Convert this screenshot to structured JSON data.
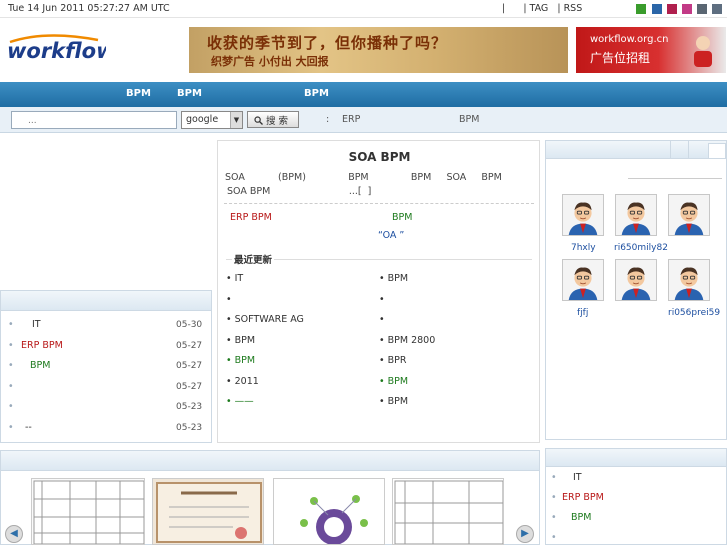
{
  "topbar": {
    "datetime": "Tue 14 Jun 2011 05:27:27 AM UTC",
    "links": "|      | TAG   | RSS",
    "swatch_colors": [
      "#3a9c2c",
      "#2b66a8",
      "#b0204e",
      "#c23a86",
      "#5a6672",
      "#5e6e80"
    ]
  },
  "header": {
    "logo_text": "workflow",
    "banner1": {
      "line1": "收获的季节到了，但你播种了吗？",
      "line2": "织梦广告  小付出  大回报"
    },
    "banner2": {
      "url": "workflow.org.cn",
      "text": "广告位招租"
    }
  },
  "nav": {
    "items": [
      "BPM",
      "BPM",
      "BPM"
    ]
  },
  "search": {
    "placeholder": "...",
    "engine": "google",
    "button_label": "搜 索",
    "hot_prefix": ":",
    "hot_links": [
      "ERP",
      "BPM"
    ]
  },
  "left_list": {
    "items": [
      {
        "text": "IT",
        "date": "05-30",
        "color": "#333333"
      },
      {
        "text": "ERP    BPM",
        "date": "05-27",
        "color": "#b81818"
      },
      {
        "text": "BPM",
        "date": "05-27",
        "color": "#1d7a1d"
      },
      {
        "text": "",
        "date": "05-27",
        "color": "#333333"
      },
      {
        "text": "",
        "date": "05-23",
        "color": "#333333"
      },
      {
        "text": "--",
        "date": "05-23",
        "color": "#333333"
      }
    ]
  },
  "center": {
    "title": "SOA  BPM",
    "intro_line1": "SOA           (BPM)              BPM              BPM     SOA     BPM",
    "intro_line2": "SOA BPM                          ...[  ]",
    "featured": [
      {
        "text": "ERP    BPM",
        "color": "red"
      },
      {
        "text": "BPM",
        "color": "green"
      },
      {
        "text": "“OA    ”",
        "color": "blue"
      }
    ],
    "latest_label": "最近更新",
    "latest_left": [
      "•      IT",
      "•",
      "• SOFTWARE AG",
      "•   BPM",
      "•   BPM",
      "• 2011",
      "•            ——"
    ],
    "latest_right": [
      "•      BPM",
      "•",
      "•",
      "• BPM    2800",
      "•      BPR",
      "• BPM",
      "•      BPM"
    ]
  },
  "members": {
    "users": [
      "7hxly",
      "ri650mily82",
      "",
      "fjfj",
      "",
      "ri056prei59"
    ]
  },
  "right_list": {
    "items": [
      {
        "text": "IT",
        "color": "#333333"
      },
      {
        "text": "ERP    BPM",
        "color": "#b81818"
      },
      {
        "text": "BPM",
        "color": "#1d7a1d"
      },
      {
        "text": "",
        "color": "#333333"
      }
    ]
  },
  "gallery": {
    "prev_icon": "chevron-left-icon",
    "next_icon": "chevron-right-icon"
  }
}
